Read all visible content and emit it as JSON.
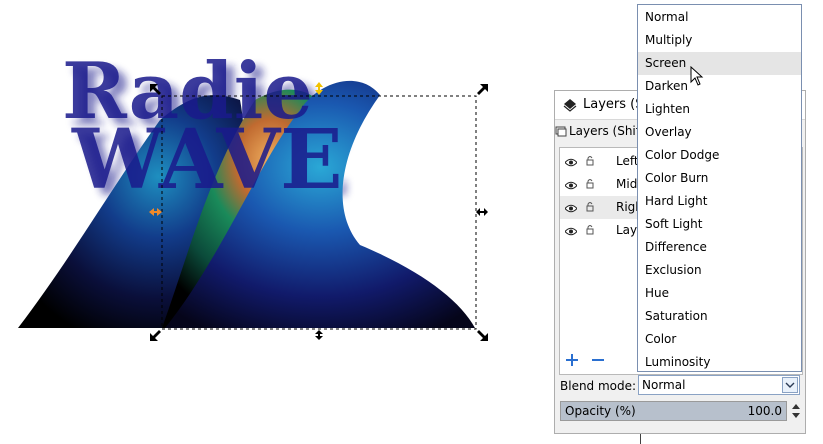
{
  "colors": {
    "text_blue": "#1a1a8c",
    "selection_handle": "#000000",
    "rotation_handle_yellow": "#f2c200",
    "skew_handle_orange": "#f08a2a"
  },
  "canvas_text": {
    "line1": "Radie",
    "line2": "WAVE"
  },
  "layers_dialog": {
    "title": "Layers (Shi",
    "tab_label": "Layers (Shift+",
    "layers": [
      {
        "name": "Left",
        "selected": false
      },
      {
        "name": "Midd",
        "selected": false
      },
      {
        "name": "Righ",
        "selected": true
      },
      {
        "name": "Laye",
        "selected": false
      }
    ],
    "blend_mode_label": "Blend mode:",
    "blend_mode_value": "Normal",
    "opacity_label": "Opacity (%)",
    "opacity_value": "100.0",
    "opacity_fraction": 1.0
  },
  "blend_dropdown": {
    "hovered": "Screen",
    "options": [
      "Normal",
      "Multiply",
      "Screen",
      "Darken",
      "Lighten",
      "Overlay",
      "Color Dodge",
      "Color Burn",
      "Hard Light",
      "Soft Light",
      "Difference",
      "Exclusion",
      "Hue",
      "Saturation",
      "Color",
      "Luminosity"
    ]
  }
}
